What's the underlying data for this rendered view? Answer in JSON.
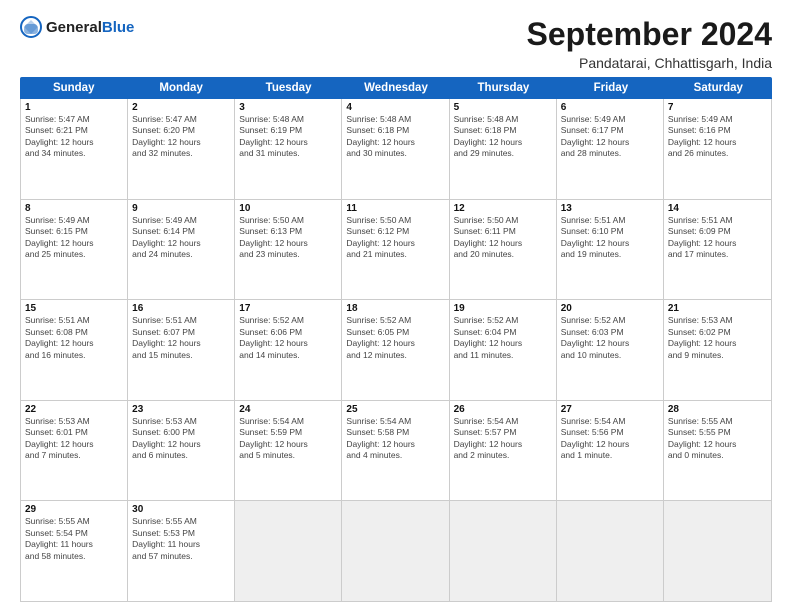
{
  "header": {
    "logo_general": "General",
    "logo_blue": "Blue",
    "main_title": "September 2024",
    "subtitle": "Pandatarai, Chhattisgarh, India"
  },
  "days": [
    "Sunday",
    "Monday",
    "Tuesday",
    "Wednesday",
    "Thursday",
    "Friday",
    "Saturday"
  ],
  "rows": [
    [
      {
        "day": "1",
        "info": "Sunrise: 5:47 AM\nSunset: 6:21 PM\nDaylight: 12 hours\nand 34 minutes."
      },
      {
        "day": "2",
        "info": "Sunrise: 5:47 AM\nSunset: 6:20 PM\nDaylight: 12 hours\nand 32 minutes."
      },
      {
        "day": "3",
        "info": "Sunrise: 5:48 AM\nSunset: 6:19 PM\nDaylight: 12 hours\nand 31 minutes."
      },
      {
        "day": "4",
        "info": "Sunrise: 5:48 AM\nSunset: 6:18 PM\nDaylight: 12 hours\nand 30 minutes."
      },
      {
        "day": "5",
        "info": "Sunrise: 5:48 AM\nSunset: 6:18 PM\nDaylight: 12 hours\nand 29 minutes."
      },
      {
        "day": "6",
        "info": "Sunrise: 5:49 AM\nSunset: 6:17 PM\nDaylight: 12 hours\nand 28 minutes."
      },
      {
        "day": "7",
        "info": "Sunrise: 5:49 AM\nSunset: 6:16 PM\nDaylight: 12 hours\nand 26 minutes."
      }
    ],
    [
      {
        "day": "8",
        "info": "Sunrise: 5:49 AM\nSunset: 6:15 PM\nDaylight: 12 hours\nand 25 minutes."
      },
      {
        "day": "9",
        "info": "Sunrise: 5:49 AM\nSunset: 6:14 PM\nDaylight: 12 hours\nand 24 minutes."
      },
      {
        "day": "10",
        "info": "Sunrise: 5:50 AM\nSunset: 6:13 PM\nDaylight: 12 hours\nand 23 minutes."
      },
      {
        "day": "11",
        "info": "Sunrise: 5:50 AM\nSunset: 6:12 PM\nDaylight: 12 hours\nand 21 minutes."
      },
      {
        "day": "12",
        "info": "Sunrise: 5:50 AM\nSunset: 6:11 PM\nDaylight: 12 hours\nand 20 minutes."
      },
      {
        "day": "13",
        "info": "Sunrise: 5:51 AM\nSunset: 6:10 PM\nDaylight: 12 hours\nand 19 minutes."
      },
      {
        "day": "14",
        "info": "Sunrise: 5:51 AM\nSunset: 6:09 PM\nDaylight: 12 hours\nand 17 minutes."
      }
    ],
    [
      {
        "day": "15",
        "info": "Sunrise: 5:51 AM\nSunset: 6:08 PM\nDaylight: 12 hours\nand 16 minutes."
      },
      {
        "day": "16",
        "info": "Sunrise: 5:51 AM\nSunset: 6:07 PM\nDaylight: 12 hours\nand 15 minutes."
      },
      {
        "day": "17",
        "info": "Sunrise: 5:52 AM\nSunset: 6:06 PM\nDaylight: 12 hours\nand 14 minutes."
      },
      {
        "day": "18",
        "info": "Sunrise: 5:52 AM\nSunset: 6:05 PM\nDaylight: 12 hours\nand 12 minutes."
      },
      {
        "day": "19",
        "info": "Sunrise: 5:52 AM\nSunset: 6:04 PM\nDaylight: 12 hours\nand 11 minutes."
      },
      {
        "day": "20",
        "info": "Sunrise: 5:52 AM\nSunset: 6:03 PM\nDaylight: 12 hours\nand 10 minutes."
      },
      {
        "day": "21",
        "info": "Sunrise: 5:53 AM\nSunset: 6:02 PM\nDaylight: 12 hours\nand 9 minutes."
      }
    ],
    [
      {
        "day": "22",
        "info": "Sunrise: 5:53 AM\nSunset: 6:01 PM\nDaylight: 12 hours\nand 7 minutes."
      },
      {
        "day": "23",
        "info": "Sunrise: 5:53 AM\nSunset: 6:00 PM\nDaylight: 12 hours\nand 6 minutes."
      },
      {
        "day": "24",
        "info": "Sunrise: 5:54 AM\nSunset: 5:59 PM\nDaylight: 12 hours\nand 5 minutes."
      },
      {
        "day": "25",
        "info": "Sunrise: 5:54 AM\nSunset: 5:58 PM\nDaylight: 12 hours\nand 4 minutes."
      },
      {
        "day": "26",
        "info": "Sunrise: 5:54 AM\nSunset: 5:57 PM\nDaylight: 12 hours\nand 2 minutes."
      },
      {
        "day": "27",
        "info": "Sunrise: 5:54 AM\nSunset: 5:56 PM\nDaylight: 12 hours\nand 1 minute."
      },
      {
        "day": "28",
        "info": "Sunrise: 5:55 AM\nSunset: 5:55 PM\nDaylight: 12 hours\nand 0 minutes."
      }
    ],
    [
      {
        "day": "29",
        "info": "Sunrise: 5:55 AM\nSunset: 5:54 PM\nDaylight: 11 hours\nand 58 minutes."
      },
      {
        "day": "30",
        "info": "Sunrise: 5:55 AM\nSunset: 5:53 PM\nDaylight: 11 hours\nand 57 minutes."
      },
      {
        "day": "",
        "info": ""
      },
      {
        "day": "",
        "info": ""
      },
      {
        "day": "",
        "info": ""
      },
      {
        "day": "",
        "info": ""
      },
      {
        "day": "",
        "info": ""
      }
    ]
  ]
}
